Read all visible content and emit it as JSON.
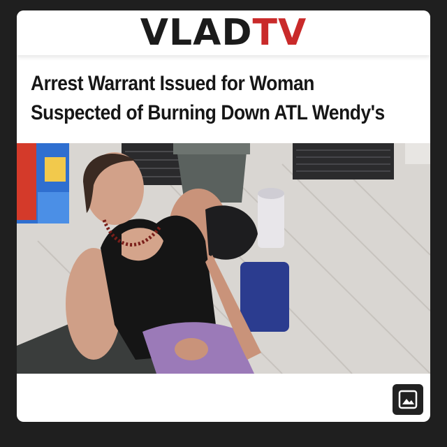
{
  "brand": {
    "name_part1": "VLAD",
    "name_part2": "TV",
    "colors": {
      "dark": "#1b1b1b",
      "red": "#c92a2a"
    }
  },
  "article": {
    "headline_line1": "Arrest Warrant Issued for Woman",
    "headline_line2": "Suspected of Burning Down ATL Wendy's"
  },
  "image": {
    "subject": "surveillance-photo"
  },
  "image_button": {
    "icon": "image-icon"
  }
}
